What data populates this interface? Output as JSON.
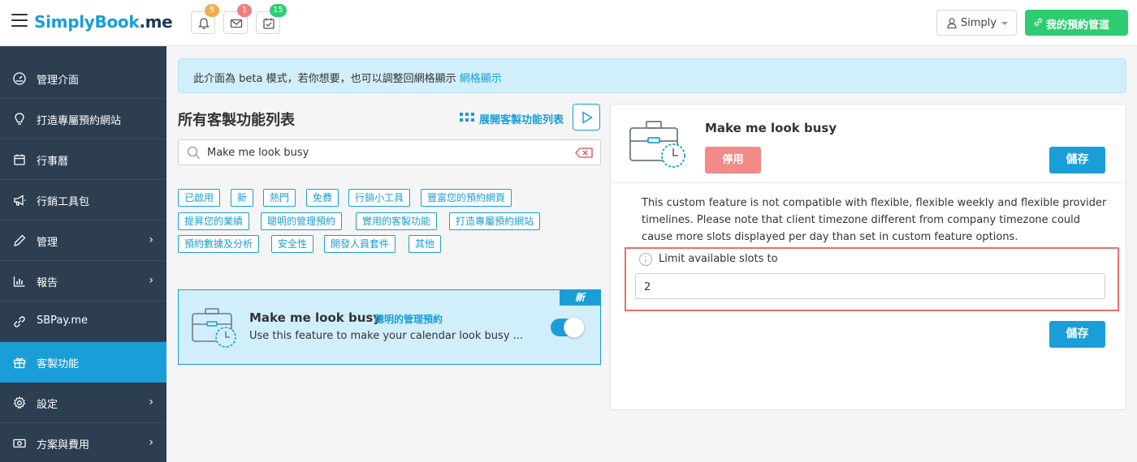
{
  "header": {
    "logo_s": "S",
    "logo_rest": "implyBook",
    "logo_me": ".me",
    "notifications": [
      {
        "icon": "bell-icon",
        "count": "5",
        "color": "#f0ad4e"
      },
      {
        "icon": "mail-icon",
        "count": "1",
        "color": "#f08080"
      },
      {
        "icon": "calendar-check-icon",
        "count": "15",
        "color": "#2ecc71"
      }
    ],
    "user_label": "Simply",
    "booking_label": "我的預約管道"
  },
  "sidebar": {
    "items": [
      {
        "label": "管理介面",
        "icon": "dashboard-icon"
      },
      {
        "label": "打造專屬預約網站",
        "icon": "lightbulb-icon"
      },
      {
        "label": "行事曆",
        "icon": "calendar-icon"
      },
      {
        "label": "行銷工具包",
        "icon": "megaphone-icon"
      },
      {
        "label": "管理",
        "icon": "pencil-icon"
      },
      {
        "label": "報告",
        "icon": "bar-chart-icon"
      },
      {
        "label": "SBPay.me",
        "icon": "link-icon"
      },
      {
        "label": "客製功能",
        "icon": "gift-icon"
      },
      {
        "label": "設定",
        "icon": "gear-icon"
      },
      {
        "label": "方案與費用",
        "icon": "money-icon"
      }
    ]
  },
  "beta": {
    "text": "此介面為 beta 模式，若你想要，也可以調整回網格顯示",
    "link": "網格顯示"
  },
  "list": {
    "title": "所有客製功能列表",
    "expand_label": "展開客製功能列表",
    "search_value": "Make me look busy"
  },
  "tags": [
    "已啟用",
    "新",
    "熱門",
    "免費",
    "行銷小工具",
    "豐富您的預約網頁",
    "提昇您的業績",
    "聰明的管理預約",
    "實用的客製功能",
    "打造專屬預約網站",
    "預約數據及分析",
    "安全性",
    "開發人員套件",
    "其他"
  ],
  "card": {
    "badge": "新",
    "title": "Make me look busy",
    "category": "聰明的管理預約",
    "description": "Use this feature to make your calendar look busy ...",
    "enabled": true
  },
  "detail": {
    "title": "Make me look busy",
    "disable_label": "停用",
    "save_label": "儲存",
    "notice": "This custom feature is not compatible with flexible, flexible weekly and flexible provider timelines. Please note that client timezone different from company timezone could cause more slots displayed per day than set in custom feature options.",
    "option_label": "Limit available slots to",
    "option_value": "2",
    "save_label_bottom": "儲存"
  },
  "colors": {
    "primary": "#1a9ed8",
    "green": "#2ecc71",
    "sidebar": "#2d3e50",
    "disable": "#f28b88",
    "highlight": "#e86f6a"
  }
}
